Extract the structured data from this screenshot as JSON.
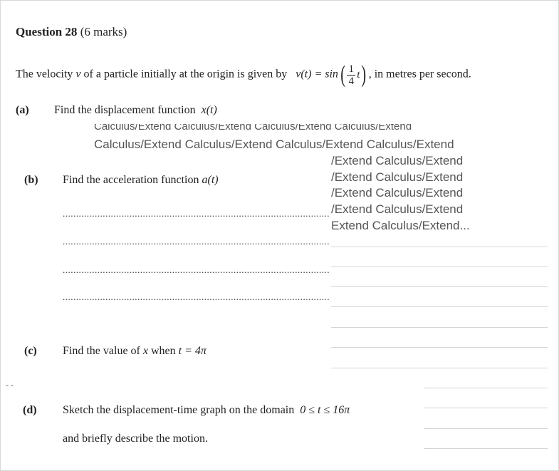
{
  "question": {
    "title": "Question 28",
    "marks": "(6 marks)"
  },
  "intro": {
    "text_before": "The velocity",
    "var_v": "v",
    "text_mid": "of a particle initially at the origin is given by",
    "func_lhs": "v(t) = sin",
    "frac_num": "1",
    "frac_den": "4",
    "frac_var": "t",
    "text_after": ", in metres per second."
  },
  "parts": {
    "a": {
      "label": "(a)",
      "text": "Find the displacement function",
      "expr": "x(t)"
    },
    "b": {
      "label": "(b)",
      "text": "Find the acceleration function",
      "expr": "a(t)"
    },
    "c": {
      "label": "(c)",
      "text": "Find the value of",
      "var": "x",
      "when": "when",
      "cond": "t = 4π"
    },
    "d": {
      "label": "(d)",
      "line1": "Sketch the displacement-time graph on the domain",
      "domain": "0 ≤ t ≤ 16π",
      "line2": "and briefly describe the motion."
    }
  },
  "overlay": {
    "cut_row": "Calculus/Extend   Calculus/Extend   Calculus/Extend   Calculus/Extend",
    "row1": "Calculus/Extend  Calculus/Extend  Calculus/Extend  Calculus/Extend",
    "row2": "/Extend  Calculus/Extend",
    "row3": "/Extend  Calculus/Extend",
    "row4": "/Extend  Calculus/Extend",
    "row5": "/Extend  Calculus/Extend",
    "row6": "Extend  Calculus/Extend..."
  },
  "dash_mark": "- -"
}
